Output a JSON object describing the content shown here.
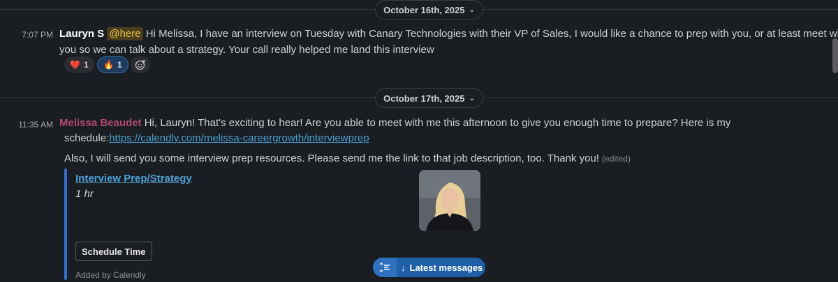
{
  "dates": [
    {
      "label": "October 16th, 2025"
    },
    {
      "label": "October 17th, 2025"
    }
  ],
  "messages": [
    {
      "time": "7:07 PM",
      "author": "Lauryn S",
      "mention": "@here",
      "text_line1": " Hi Melissa, I have an interview on Tuesday with Canary Technologies with their VP of Sales, I would like a chance to prep with you, or at least meet with",
      "text_line2": "you so we can talk about a strategy. Your call really helped me land this interview",
      "reactions": [
        {
          "emoji": "❤️",
          "count": "1",
          "active": false
        },
        {
          "emoji": "🔥",
          "count": "1",
          "active": true
        }
      ],
      "add_reaction_icon": "add-emoji-icon"
    },
    {
      "time": "11:35 AM",
      "author": "Melissa Beaudet",
      "text_line1": " Hi, Lauryn!  That's exciting to hear!  Are you able to meet with me this afternoon to give you enough time to prepare?  Here is my",
      "text_line2_prefix": "schedule:",
      "link": "https://calendly.com/melissa-careergrowth/interviewprep",
      "text_line3": "Also, I will send you some interview prep resources.  Please send me the link to that job description, too.  Thank you!",
      "edited": "(edited)",
      "card": {
        "title": "Interview Prep/Strategy",
        "duration": "1 hr",
        "button": "Schedule Time",
        "footer": "Added by Calendly",
        "accent": "#2f6fd6"
      }
    }
  ],
  "latest_button": {
    "arrow": "↓",
    "label": "Latest messages",
    "icon": "thread-list-icon"
  },
  "colors": {
    "background": "#1a1d21",
    "link": "#4aa0d5",
    "mention_bg": "#4a3d1b",
    "mention_text": "#e8c547",
    "author2": "#b04a6b"
  }
}
